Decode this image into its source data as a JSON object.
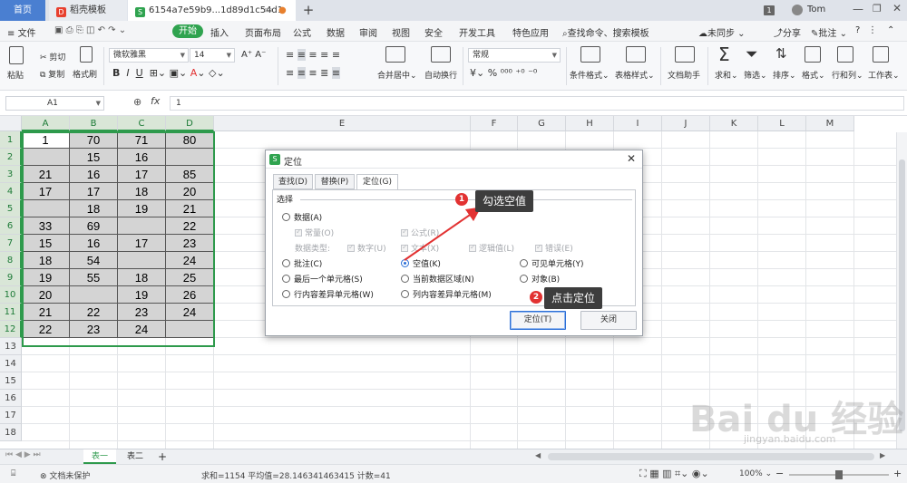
{
  "tabs": {
    "home": "首页",
    "templates": "稻壳模板",
    "doc": "6154a7e59b9...1d89d1c54d1"
  },
  "window": {
    "badge": "1",
    "user": "Tom"
  },
  "menu": {
    "file": "文件",
    "start": "开始",
    "items": [
      "插入",
      "页面布局",
      "公式",
      "数据",
      "审阅",
      "视图",
      "安全",
      "开发工具",
      "特色应用"
    ],
    "search": "查找命令、搜索模板",
    "sync": "未同步",
    "share": "分享",
    "annotate": "批注"
  },
  "ribbon": {
    "paste": "粘贴",
    "cut": "剪切",
    "copy": "复制",
    "format_painter": "格式刷",
    "font": "微软雅黑",
    "font_size": "14",
    "merge": "合并居中",
    "wrap": "自动换行",
    "number_format": "常规",
    "cond_format": "条件格式",
    "table_style": "表格样式",
    "doc_helper": "文档助手",
    "sum": "求和",
    "filter": "筛选",
    "sort": "排序",
    "format": "格式",
    "rowcol": "行和列",
    "sheet": "工作表"
  },
  "formula_bar": {
    "cell_ref": "A1",
    "fx": "fx",
    "value": "1"
  },
  "grid": {
    "columns": [
      "A",
      "B",
      "C",
      "D",
      "E",
      "F",
      "G",
      "H",
      "I",
      "J",
      "K",
      "L",
      "M"
    ],
    "rows": [
      "1",
      "2",
      "3",
      "4",
      "5",
      "6",
      "7",
      "8",
      "9",
      "10",
      "11",
      "12",
      "13",
      "14",
      "15",
      "16",
      "17",
      "18"
    ],
    "data": [
      [
        "1",
        "70",
        "71",
        "80"
      ],
      [
        "",
        "15",
        "16",
        ""
      ],
      [
        "21",
        "16",
        "17",
        "85"
      ],
      [
        "17",
        "17",
        "18",
        "20"
      ],
      [
        "",
        "18",
        "19",
        "21"
      ],
      [
        "33",
        "69",
        "",
        "22"
      ],
      [
        "15",
        "16",
        "17",
        "23"
      ],
      [
        "18",
        "54",
        "",
        "24"
      ],
      [
        "19",
        "55",
        "18",
        "25"
      ],
      [
        "20",
        "",
        "19",
        "26"
      ],
      [
        "21",
        "22",
        "23",
        "24"
      ],
      [
        "22",
        "23",
        "24",
        ""
      ]
    ]
  },
  "dialog": {
    "title": "定位",
    "tabs": [
      "查找(D)",
      "替换(P)",
      "定位(G)"
    ],
    "section": "选择",
    "data_option": "数据(A)",
    "constant": "常量(O)",
    "formula": "公式(R)",
    "data_type_label": "数据类型:",
    "types": [
      "数字(U)",
      "文本(X)",
      "逻辑值(L)",
      "错误(E)"
    ],
    "options": {
      "comments": "批注(C)",
      "blanks": "空值(K)",
      "visible_cells": "可见单元格(Y)",
      "last_cell": "最后一个单元格(S)",
      "current_region": "当前数据区域(N)",
      "objects": "对象(B)",
      "row_diff": "行内容差异单元格(W)",
      "col_diff": "列内容差异单元格(M)"
    },
    "ok": "定位(T)",
    "close": "关闭"
  },
  "callouts": {
    "one": {
      "num": "1",
      "text": "勾选空值"
    },
    "two": {
      "num": "2",
      "text": "点击定位"
    }
  },
  "sheets": [
    "表一",
    "表二"
  ],
  "status": {
    "protect": "文档未保护",
    "stats": "求和=1154  平均值=28.146341463415  计数=41",
    "zoom": "100%"
  },
  "watermark": {
    "main": "Bai du 经验",
    "sub": "jingyan.baidu.com"
  }
}
